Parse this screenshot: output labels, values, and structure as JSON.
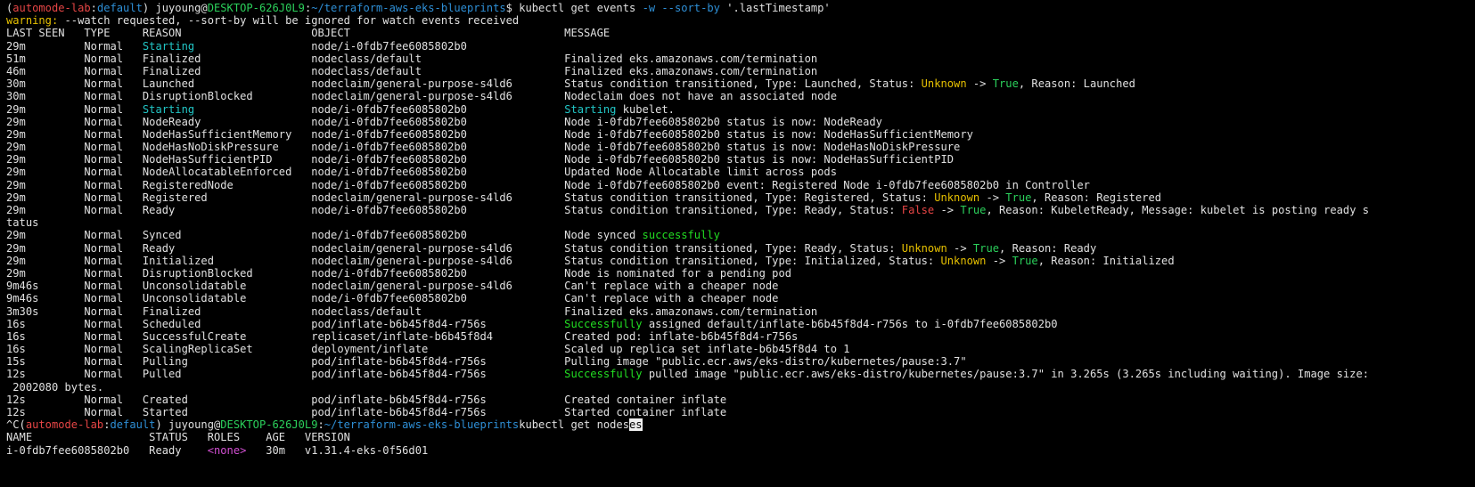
{
  "colors": {
    "background": "#000000",
    "default_text": "#e0e0e0",
    "blue": "#2e8fd6",
    "green": "#2bd05b",
    "red": "#e64545",
    "yellow": "#e6c000",
    "bright_green": "#22dd22",
    "cyan": "#22c7c7",
    "magenta": "#d450d4"
  },
  "terminal": {
    "lines": [
      [
        {
          "t": "("
        },
        {
          "t": "automode-lab",
          "c": "red"
        },
        {
          "t": ":"
        },
        {
          "t": "default",
          "c": "blue"
        },
        {
          "t": ") juyoung@"
        },
        {
          "t": "DESKTOP-626J0L9",
          "c": "green"
        },
        {
          "t": ":"
        },
        {
          "t": "~/terraform-aws-eks-blueprints",
          "c": "blue"
        },
        {
          "t": "$ kubectl get events "
        },
        {
          "t": "-w --sort-by",
          "c": "blue"
        },
        {
          "t": " '.lastTimestamp'"
        }
      ],
      [
        {
          "t": "warning:",
          "c": "yellow"
        },
        {
          "t": " --watch requested, --sort-by will be ignored for watch events received"
        }
      ],
      [
        {
          "t": "LAST SEEN   TYPE     REASON                    OBJECT                                 MESSAGE"
        }
      ],
      [
        {
          "t": "29m         Normal   "
        },
        {
          "t": "Starting",
          "c": "cyan"
        },
        {
          "t": "                  node/i-0fdb7fee6085802b0"
        }
      ],
      [
        {
          "t": "51m         Normal   Finalized                 nodeclass/default                      Finalized eks.amazonaws.com/termination"
        }
      ],
      [
        {
          "t": "46m         Normal   Finalized                 nodeclass/default                      Finalized eks.amazonaws.com/termination"
        }
      ],
      [
        {
          "t": "30m         Normal   Launched                  nodeclaim/general-purpose-s4ld6        Status condition transitioned, Type: Launched, Status: "
        },
        {
          "t": "Unknown",
          "c": "yellow"
        },
        {
          "t": " -> "
        },
        {
          "t": "True",
          "c": "green"
        },
        {
          "t": ", Reason: Launched"
        }
      ],
      [
        {
          "t": "30m         Normal   DisruptionBlocked         nodeclaim/general-purpose-s4ld6        Nodeclaim does not have an associated node"
        }
      ],
      [
        {
          "t": "29m         Normal   "
        },
        {
          "t": "Starting",
          "c": "cyan"
        },
        {
          "t": "                  node/i-0fdb7fee6085802b0               "
        },
        {
          "t": "Starting",
          "c": "cyan"
        },
        {
          "t": " kubelet."
        }
      ],
      [
        {
          "t": "29m         Normal   NodeReady                 node/i-0fdb7fee6085802b0               Node i-0fdb7fee6085802b0 status is now: NodeReady"
        }
      ],
      [
        {
          "t": "29m         Normal   NodeHasSufficientMemory   node/i-0fdb7fee6085802b0               Node i-0fdb7fee6085802b0 status is now: NodeHasSufficientMemory"
        }
      ],
      [
        {
          "t": "29m         Normal   NodeHasNoDiskPressure     node/i-0fdb7fee6085802b0               Node i-0fdb7fee6085802b0 status is now: NodeHasNoDiskPressure"
        }
      ],
      [
        {
          "t": "29m         Normal   NodeHasSufficientPID      node/i-0fdb7fee6085802b0               Node i-0fdb7fee6085802b0 status is now: NodeHasSufficientPID"
        }
      ],
      [
        {
          "t": "29m         Normal   NodeAllocatableEnforced   node/i-0fdb7fee6085802b0               Updated Node Allocatable limit across pods"
        }
      ],
      [
        {
          "t": "29m         Normal   RegisteredNode            node/i-0fdb7fee6085802b0               Node i-0fdb7fee6085802b0 event: Registered Node i-0fdb7fee6085802b0 in Controller"
        }
      ],
      [
        {
          "t": "29m         Normal   Registered                nodeclaim/general-purpose-s4ld6        Status condition transitioned, Type: Registered, Status: "
        },
        {
          "t": "Unknown",
          "c": "yellow"
        },
        {
          "t": " -> "
        },
        {
          "t": "True",
          "c": "green"
        },
        {
          "t": ", Reason: Registered"
        }
      ],
      [
        {
          "t": "29m         Normal   Ready                     node/i-0fdb7fee6085802b0               Status condition transitioned, Type: Ready, Status: "
        },
        {
          "t": "False",
          "c": "red"
        },
        {
          "t": " -> "
        },
        {
          "t": "True",
          "c": "green"
        },
        {
          "t": ", Reason: KubeletReady, Message: kubelet is posting ready s"
        }
      ],
      [
        {
          "t": "tatus"
        }
      ],
      [
        {
          "t": "29m         Normal   Synced                    node/i-0fdb7fee6085802b0               Node synced "
        },
        {
          "t": "successfully",
          "c": "bright_green"
        }
      ],
      [
        {
          "t": "29m         Normal   Ready                     nodeclaim/general-purpose-s4ld6        Status condition transitioned, Type: Ready, Status: "
        },
        {
          "t": "Unknown",
          "c": "yellow"
        },
        {
          "t": " -> "
        },
        {
          "t": "True",
          "c": "green"
        },
        {
          "t": ", Reason: Ready"
        }
      ],
      [
        {
          "t": "29m         Normal   Initialized               nodeclaim/general-purpose-s4ld6        Status condition transitioned, Type: Initialized, Status: "
        },
        {
          "t": "Unknown",
          "c": "yellow"
        },
        {
          "t": " -> "
        },
        {
          "t": "True",
          "c": "green"
        },
        {
          "t": ", Reason: Initialized"
        }
      ],
      [
        {
          "t": "29m         Normal   DisruptionBlocked         node/i-0fdb7fee6085802b0               Node is nominated for a pending pod"
        }
      ],
      [
        {
          "t": "9m46s       Normal   Unconsolidatable          nodeclaim/general-purpose-s4ld6        Can't replace with a cheaper node"
        }
      ],
      [
        {
          "t": "9m46s       Normal   Unconsolidatable          node/i-0fdb7fee6085802b0               Can't replace with a cheaper node"
        }
      ],
      [
        {
          "t": "3m30s       Normal   Finalized                 nodeclass/default                      Finalized eks.amazonaws.com/termination"
        }
      ],
      [
        {
          "t": "16s         Normal   Scheduled                 pod/inflate-b6b45f8d4-r756s            "
        },
        {
          "t": "Successfully",
          "c": "bright_green"
        },
        {
          "t": " assigned default/inflate-b6b45f8d4-r756s to i-0fdb7fee6085802b0"
        }
      ],
      [
        {
          "t": "16s         Normal   SuccessfulCreate          replicaset/inflate-b6b45f8d4           Created pod: inflate-b6b45f8d4-r756s"
        }
      ],
      [
        {
          "t": "16s         Normal   ScalingReplicaSet         deployment/inflate                     Scaled up replica set inflate-b6b45f8d4 to 1"
        }
      ],
      [
        {
          "t": "15s         Normal   Pulling                   pod/inflate-b6b45f8d4-r756s            Pulling image \"public.ecr.aws/eks-distro/kubernetes/pause:3.7\""
        }
      ],
      [
        {
          "t": "12s         Normal   Pulled                    pod/inflate-b6b45f8d4-r756s            "
        },
        {
          "t": "Successfully",
          "c": "bright_green"
        },
        {
          "t": " pulled image \"public.ecr.aws/eks-distro/kubernetes/pause:3.7\" in 3.265s (3.265s including waiting). Image size:"
        }
      ],
      [
        {
          "t": " 2002080 bytes."
        }
      ],
      [
        {
          "t": "12s         Normal   Created                   pod/inflate-b6b45f8d4-r756s            Created container inflate"
        }
      ],
      [
        {
          "t": "12s         Normal   Started                   pod/inflate-b6b45f8d4-r756s            Started container inflate"
        }
      ],
      [
        {
          "t": "^C("
        },
        {
          "t": "automode-lab",
          "c": "red"
        },
        {
          "t": ":"
        },
        {
          "t": "default",
          "c": "blue"
        },
        {
          "t": ") juyoung@"
        },
        {
          "t": "DESKTOP-626J0L9",
          "c": "green"
        },
        {
          "t": ":"
        },
        {
          "t": "~/terraform-aws-eks-blueprints",
          "c": "blue"
        },
        {
          "t": "kubectl get nodes"
        },
        {
          "t": "es",
          "c": "cursor"
        }
      ],
      [
        {
          "t": "NAME                  STATUS   ROLES    AGE   VERSION"
        }
      ],
      [
        {
          "t": "i-0fdb7fee6085802b0   Ready    "
        },
        {
          "t": "<none>",
          "c": "magenta"
        },
        {
          "t": "   30m   v1.31.4-eks-0f56d01"
        }
      ]
    ]
  }
}
